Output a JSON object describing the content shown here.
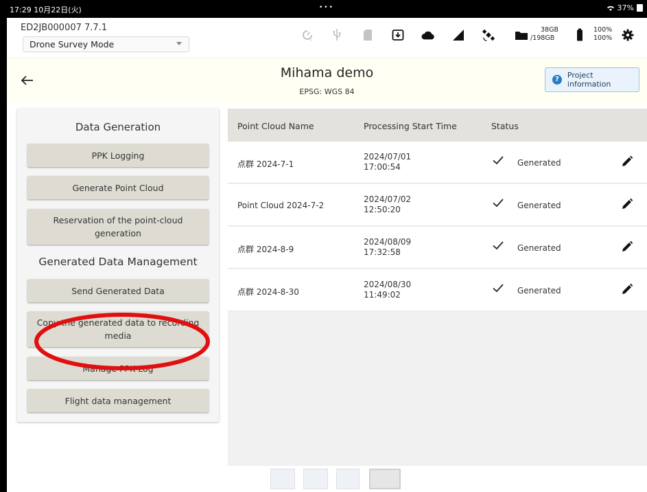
{
  "status_bar": {
    "time_date": "17:29  10月22日(火)",
    "center_dots": "•••",
    "battery_percent": "37%"
  },
  "toolbar": {
    "serial": "ED2JB000007   7.7.1",
    "mode_selected": "Drone Survey Mode",
    "storage_used": "38GB",
    "storage_total": "/198GB",
    "battery_1": "100%",
    "battery_2": "100%",
    "icons": [
      "timer-icon",
      "usb-icon",
      "sd-card-icon",
      "download-icon",
      "cloud-icon",
      "signal-icon",
      "satellite-icon",
      "folder-icon",
      "battery-icon",
      "gear-icon"
    ]
  },
  "header": {
    "title": "Mihama demo",
    "epsg": "EPSG: WGS 84",
    "info_button": "Project information"
  },
  "left_panel": {
    "data_generation_title": "Data Generation",
    "buttons_generation": [
      "PPK Logging",
      "Generate Point Cloud",
      "Reservation of the point-cloud generation"
    ],
    "management_title": "Generated Data Management",
    "buttons_management": [
      "Send Generated Data",
      "Copy the generated data to recording media",
      "Manage PPK Log",
      "Flight data management"
    ]
  },
  "table": {
    "headers": [
      "Point Cloud Name",
      "Processing Start Time",
      "Status"
    ],
    "rows": [
      {
        "name": "点群 2024-7-1",
        "date": "2024/07/01",
        "time": "17:00:54",
        "status": "Generated"
      },
      {
        "name": "Point Cloud 2024-7-2",
        "date": "2024/07/02",
        "time": "12:50:20",
        "status": "Generated"
      },
      {
        "name": "点群 2024-8-9",
        "date": "2024/08/09",
        "time": "17:32:58",
        "status": "Generated"
      },
      {
        "name": "点群 2024-8-30",
        "date": "2024/08/30",
        "time": "11:49:02",
        "status": "Generated"
      }
    ]
  },
  "colors": {
    "header_bg": "#fffff4",
    "button_bg": "#dedcd2",
    "highlight_ellipse": "#e11010",
    "info_button_border": "#9cc3e6"
  }
}
